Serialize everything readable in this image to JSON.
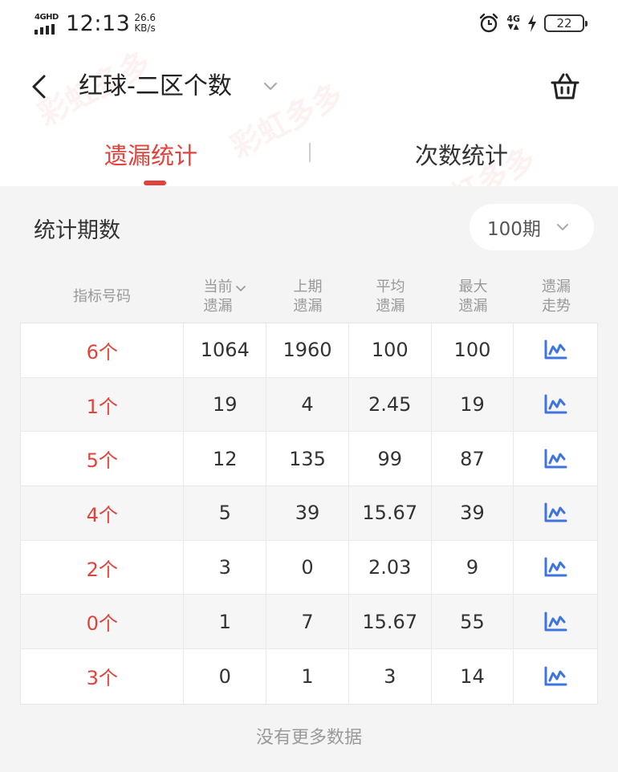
{
  "status_bar": {
    "network": "4GHD",
    "time": "12:13",
    "speed_value": "26.6",
    "speed_unit": "KB/s",
    "network2": "4G",
    "network2_arrows": "▼▲",
    "battery": "22"
  },
  "header": {
    "title": "红球-二区个数",
    "icons": {
      "back": "chevron-left-icon",
      "title_dropdown": "chevron-down-icon",
      "basket": "basket-icon"
    }
  },
  "tabs": [
    {
      "label": "遗漏统计",
      "active": true
    },
    {
      "label": "次数统计",
      "active": false
    }
  ],
  "filter": {
    "label": "统计期数",
    "selected": "100期"
  },
  "table": {
    "columns": [
      {
        "line1": "指标号码",
        "line2": ""
      },
      {
        "line1": "当前",
        "line2": "遗漏"
      },
      {
        "line1": "上期",
        "line2": "遗漏"
      },
      {
        "line1": "平均",
        "line2": "遗漏"
      },
      {
        "line1": "最大",
        "line2": "遗漏"
      },
      {
        "line1": "遗漏",
        "line2": "走势"
      }
    ],
    "rows": [
      {
        "label": "6个",
        "current": "1064",
        "previous": "1960",
        "average": "100",
        "max": "100"
      },
      {
        "label": "1个",
        "current": "19",
        "previous": "4",
        "average": "2.45",
        "max": "19"
      },
      {
        "label": "5个",
        "current": "12",
        "previous": "135",
        "average": "99",
        "max": "87"
      },
      {
        "label": "4个",
        "current": "5",
        "previous": "39",
        "average": "15.67",
        "max": "39"
      },
      {
        "label": "2个",
        "current": "3",
        "previous": "0",
        "average": "2.03",
        "max": "9"
      },
      {
        "label": "0个",
        "current": "1",
        "previous": "7",
        "average": "15.67",
        "max": "55"
      },
      {
        "label": "3个",
        "current": "0",
        "previous": "1",
        "average": "3",
        "max": "14"
      }
    ]
  },
  "footer": {
    "no_more": "没有更多数据"
  },
  "watermark": "彩虹多多",
  "colors": {
    "accent": "#e0433c",
    "trend_icon": "#3f74e0",
    "bg_gray": "#f4f4f4"
  }
}
